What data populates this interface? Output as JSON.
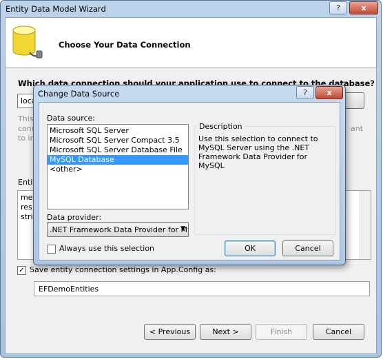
{
  "wizard": {
    "title": "Entity Data Model Wizard",
    "titlebar_help": "?",
    "titlebar_close": "x",
    "header_title": "Choose Your Data Connection",
    "question": "Which data connection should your application use to connect to the database?",
    "connection_value": "local",
    "grey_left_text": "This conn to in",
    "grey_right_text": "ant",
    "entity_label": "Entit",
    "connection_string_lines": [
      "met",
      "res:/",
      "strin"
    ],
    "save_settings_label": "Save entity connection settings in App.Config as:",
    "save_settings_checked": true,
    "entity_container_name": "EFDemoEntities",
    "buttons": {
      "previous": "< Previous",
      "next": "Next >",
      "finish": "Finish",
      "cancel": "Cancel"
    }
  },
  "dialog": {
    "title": "Change Data Source",
    "titlebar_help": "?",
    "titlebar_close": "x",
    "data_source_label": "Data source:",
    "data_sources": [
      "Microsoft SQL Server",
      "Microsoft SQL Server Compact 3.5",
      "Microsoft SQL Server Database File",
      "MySQL Database",
      "<other>"
    ],
    "selected_index": 3,
    "description_label": "Description",
    "description_text": "Use this selection to connect to MySQL Server using the .NET Framework Data Provider for MySQL",
    "data_provider_label": "Data provider:",
    "data_provider_value": ".NET Framework Data Provider for MySQL",
    "always_use_label": "Always use this selection",
    "always_use_checked": false,
    "ok_label": "OK",
    "cancel_label": "Cancel"
  }
}
